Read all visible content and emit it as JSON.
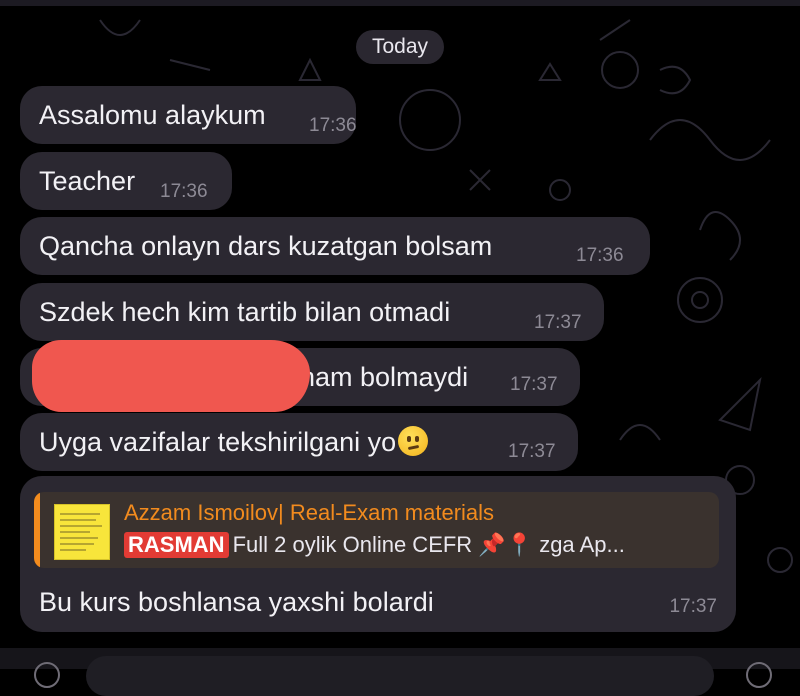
{
  "date_separator": "Today",
  "messages": [
    {
      "text": "Assalomu alaykum",
      "time": "17:36"
    },
    {
      "text": "Teacher",
      "time": "17:36"
    },
    {
      "text": "Qancha onlayn dars kuzatgan bolsam",
      "time": "17:36"
    },
    {
      "text": "Szdek hech kim tartib bilan otmadi",
      "time": "17:37"
    },
    {
      "text": "ham bolmaydi",
      "time": "17:37"
    },
    {
      "text": "Uyga vazifalar tekshirilgani yo",
      "time": "17:37",
      "emoji": "confused-face"
    }
  ],
  "reply_message": {
    "quoted_sender": "Azzam Ismoilov| Real-Exam materials",
    "quoted_badge": "RASMAN",
    "quoted_text": "Full 2 oylik Online CEFR 📌📍 zga Ap...",
    "text": "Bu kurs boshlansa yaxshi bolardi",
    "time": "17:37"
  },
  "colors": {
    "background": "#000000",
    "bubble": "#2b2831",
    "accent_orange": "#f28b1e",
    "redaction": "#f0574f"
  }
}
